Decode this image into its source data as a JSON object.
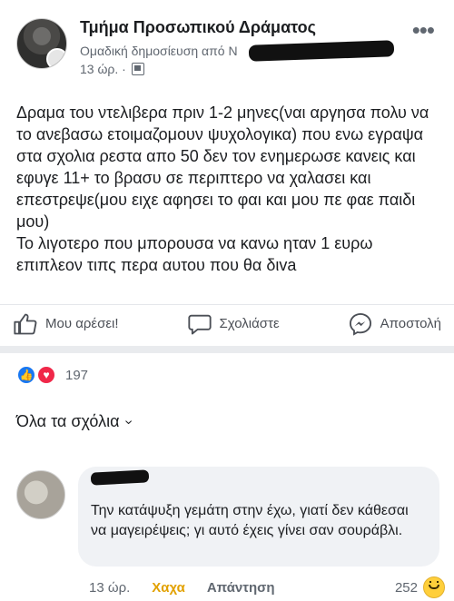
{
  "post": {
    "group_name": "Τμήμα Προσωπικού Δράματος",
    "subtitle": "Ομαδική δημοσίευση από Ν",
    "subtitle_end": "· ",
    "time": "13 ώρ. ·",
    "text": "Δραμα του ντελιβερα πριν 1-2 μηνες(ναι αργησα πολυ να το ανεβασω ετοιμαζομουν ψυχολογικα) που ενω εγραψα στα σχολια ρεστα απο 50 δεν τον ενημερωσε κανεις και εφυγε 11+ το βρασυ σε περιπτερο να χαλασει και επεστρεψε(μου ειχε αφησει το φαι και μου πε φαε παιδι μου)\nΤο λιγοτερο που μπορουσα να κανω ηταν 1 ευρω επιπλεον τιπς περα αυτου που θα διva"
  },
  "actions": {
    "like": "Μου αρέσει!",
    "comment": "Σχολιάστε",
    "send": "Αποστολή"
  },
  "reactions": {
    "count": "197"
  },
  "comments_header": "Όλα τα σχόλια",
  "comment": {
    "text": "Την κατάψυξη γεμάτη στην έχω, γιατί δεν κάθεσαι να μαγειρέψεις; γι αυτό έχεις γίνει σαν σουράβλι.",
    "time": "13 ώρ.",
    "haha": "Χαχα",
    "reply": "Απάντηση",
    "reaction_count": "252"
  },
  "colors": {
    "accent_blue": "#1877f2",
    "love_red": "#f02849",
    "haha_yellow": "#e2a100"
  }
}
